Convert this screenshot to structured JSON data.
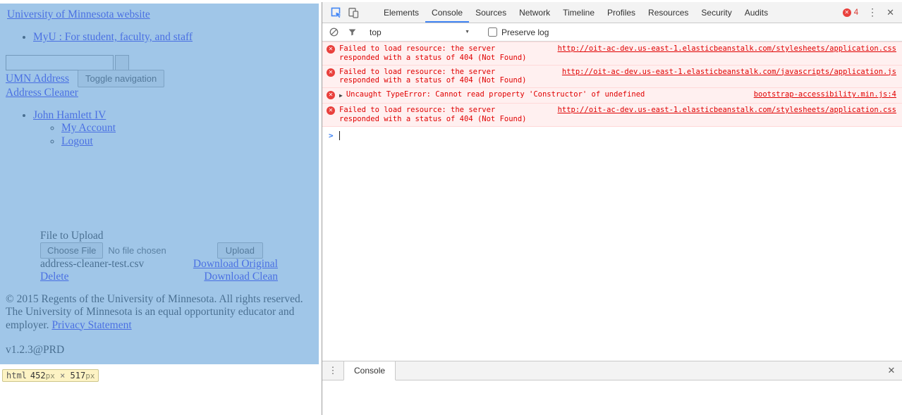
{
  "page": {
    "site_link": "University of Minnesota website",
    "myu_link": "MyU : For student, faculty, and staff",
    "search_input_value": "",
    "umn_address_link": "UMN Address",
    "toggle_nav_label": "Toggle navigation",
    "address_cleaner_link": "Address Cleaner",
    "user_name_link": "John Hamlett IV",
    "my_account_link": "My Account",
    "logout_link": "Logout",
    "file_to_upload_label": "File to Upload",
    "choose_file_label": "Choose File",
    "no_file_chosen": "No file chosen",
    "upload_label": "Upload",
    "file_name": "address-cleaner-test.csv",
    "download_original_link": "Download Original",
    "delete_link": "Delete",
    "download_clean_link": "Download Clean",
    "footer_text": "© 2015 Regents of the University of Minnesota. All rights reserved. The University of Minnesota is an equal opportunity educator and employer. ",
    "privacy_link": "Privacy Statement",
    "version": "v1.2.3@PRD",
    "inspect_tooltip": {
      "tag": "html",
      "width_value": "452",
      "height_value": "517",
      "unit": "px",
      "times": "×"
    }
  },
  "devtools": {
    "tabs": [
      {
        "label": "Elements"
      },
      {
        "label": "Console"
      },
      {
        "label": "Sources"
      },
      {
        "label": "Network"
      },
      {
        "label": "Timeline"
      },
      {
        "label": "Profiles"
      },
      {
        "label": "Resources"
      },
      {
        "label": "Security"
      },
      {
        "label": "Audits"
      }
    ],
    "active_tab": "Console",
    "error_count": "4",
    "console_toolbar": {
      "context": "top",
      "preserve_log_label": "Preserve log"
    },
    "console": {
      "rows": [
        {
          "message": "Failed to load resource: the server responded with a status of 404 (Not Found)",
          "source": "http://oit-ac-dev.us-east-1.elasticbeanstalk.com/stylesheets/application.css"
        },
        {
          "message": "Failed to load resource: the server responded with a status of 404 (Not Found)",
          "source": "http://oit-ac-dev.us-east-1.elasticbeanstalk.com/javascripts/application.js"
        },
        {
          "message": "Uncaught TypeError: Cannot read property 'Constructor' of undefined",
          "source": "bootstrap-accessibility.min.js:4",
          "expandable": true
        },
        {
          "message": "Failed to load resource: the server responded with a status of 404 (Not Found)",
          "source": "http://oit-ac-dev.us-east-1.elasticbeanstalk.com/stylesheets/application.css"
        }
      ]
    },
    "drawer": {
      "tab_label": "Console"
    }
  },
  "icons": {
    "close": "✕",
    "overflow_menu": "⋮",
    "dropdown_arrow": "▼",
    "expand_arrow": "▶",
    "prompt_chevron": ">",
    "error_x": "✕"
  },
  "colors": {
    "highlight_overlay": "rgba(111,168,220,0.66)",
    "error_text": "#e00000",
    "error_bg": "#fff0f0",
    "tab_accent": "#4285f4",
    "tooltip_bg": "#fdf3c4"
  }
}
